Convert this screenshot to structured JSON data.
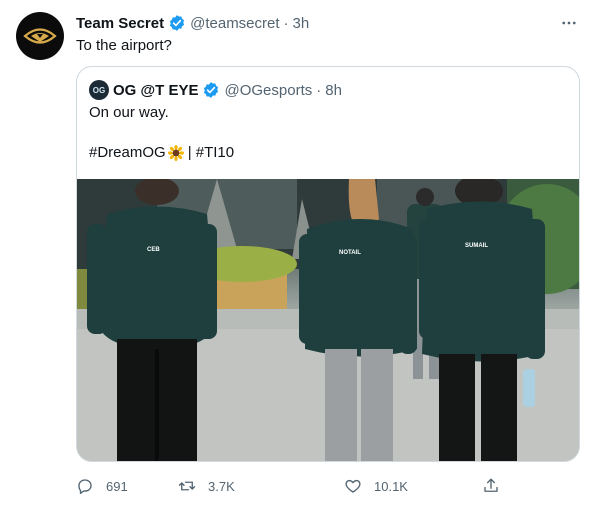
{
  "tweet": {
    "author_name": "Team Secret",
    "handle": "@teamsecret",
    "time": "3h",
    "text": "To the airport?"
  },
  "quote": {
    "author_name": "OG @T EYE",
    "handle": "@OGesports",
    "time": "8h",
    "avatar_label": "OG",
    "line1": "On our way.",
    "hashtag1": "#DreamOG",
    "separator": "| #TI10",
    "media": {
      "jacket_labels": [
        "CEB",
        "NOTAIL",
        "SUMAIL"
      ]
    }
  },
  "actions": {
    "replies": "691",
    "retweets": "3.7K",
    "likes": "10.1K"
  },
  "colors": {
    "verified_blue": "#1d9bf0",
    "secondary_text": "#536471",
    "border": "#cfd9de",
    "jacket_teal": "#1e3f3e"
  },
  "icons": [
    "team-secret-logo",
    "verified-badge-icon",
    "more-options-icon",
    "sunflower-emoji",
    "reply-icon",
    "retweet-icon",
    "like-icon",
    "share-icon"
  ]
}
